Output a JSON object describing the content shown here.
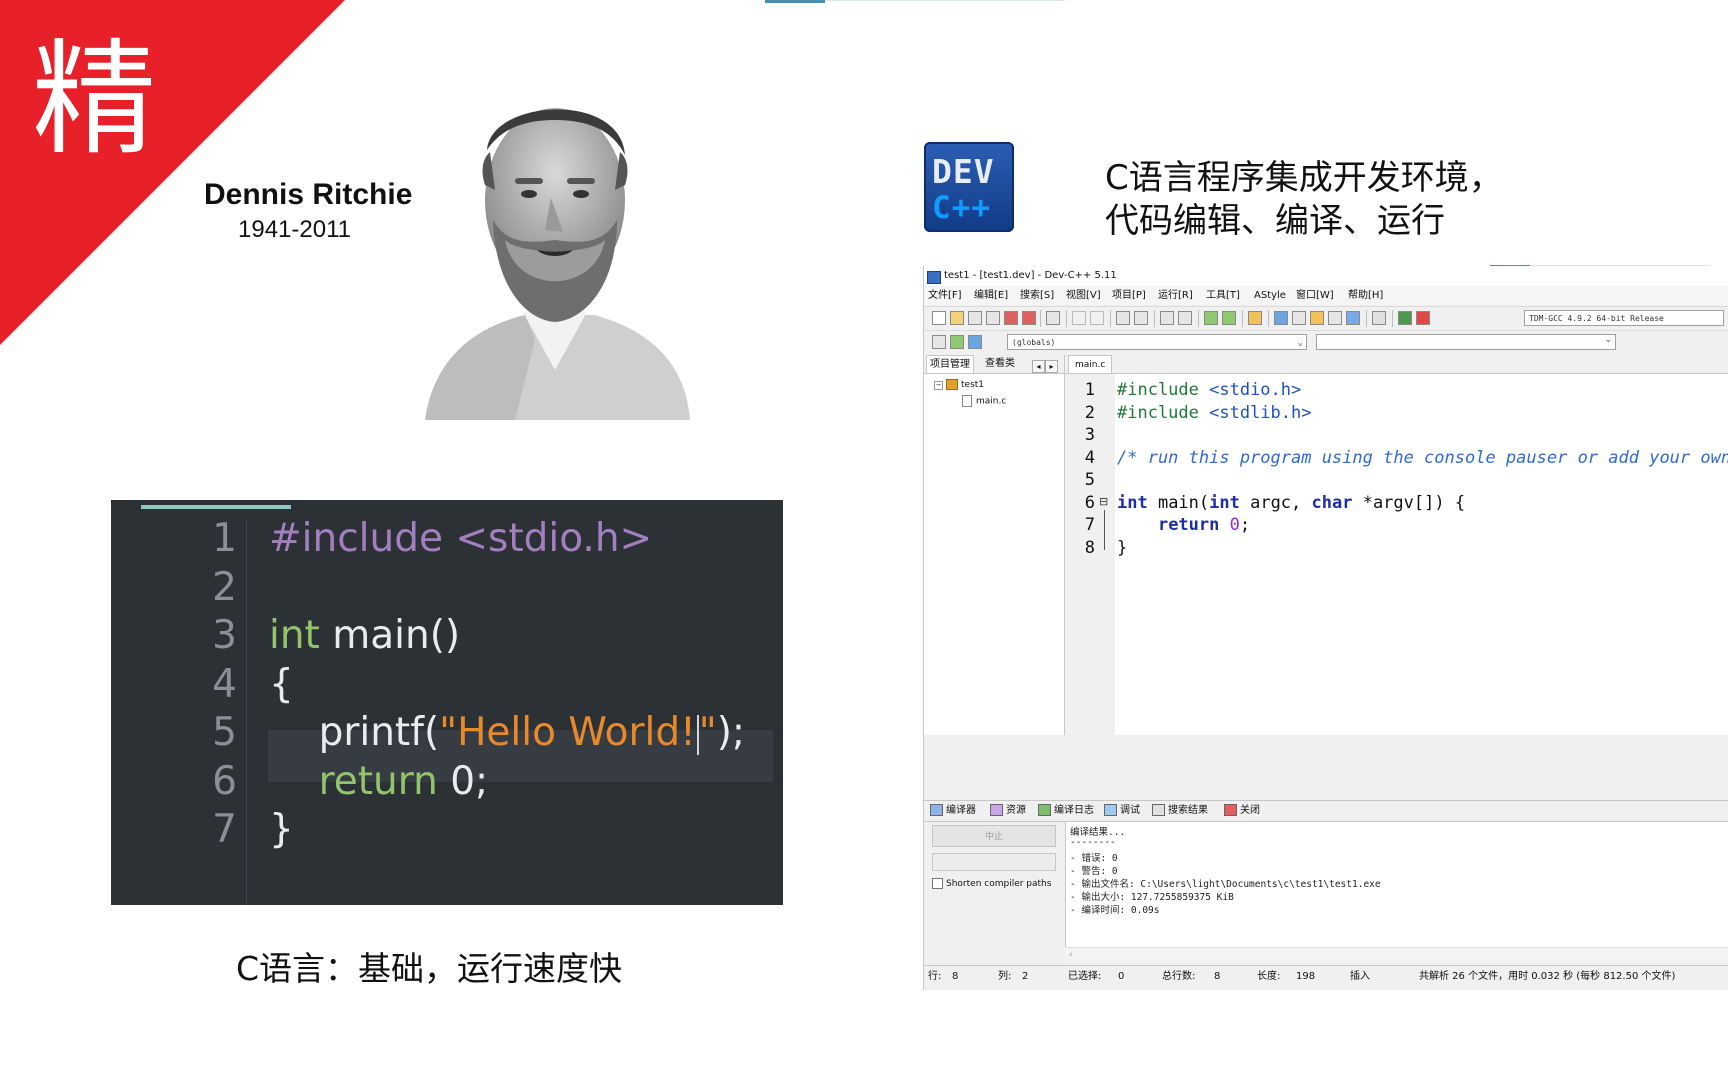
{
  "corner": {
    "char": "精"
  },
  "ritchie": {
    "name": "Dennis Ritchie",
    "years": "1941-2011"
  },
  "code_example": {
    "lines": [
      {
        "num": "1",
        "tokens": [
          {
            "t": "#include <stdio.h>",
            "c": "pre"
          }
        ]
      },
      {
        "num": "2",
        "tokens": []
      },
      {
        "num": "3",
        "tokens": [
          {
            "t": "int",
            "c": "kw"
          },
          {
            "t": " main()",
            "c": ""
          }
        ]
      },
      {
        "num": "4",
        "tokens": [
          {
            "t": "{",
            "c": ""
          }
        ]
      },
      {
        "num": "5",
        "tokens": [
          {
            "t": "    printf(",
            "c": ""
          },
          {
            "t": "\"Hello World!",
            "c": "str"
          },
          {
            "t": "CARET",
            "c": "caret"
          },
          {
            "t": "\"",
            "c": "str"
          },
          {
            "t": ");",
            "c": ""
          }
        ]
      },
      {
        "num": "6",
        "tokens": [
          {
            "t": "    ",
            "c": ""
          },
          {
            "t": "return",
            "c": "kw"
          },
          {
            "t": " 0;",
            "c": ""
          }
        ]
      },
      {
        "num": "7",
        "tokens": [
          {
            "t": "}",
            "c": ""
          }
        ]
      }
    ],
    "colors": {
      "background": "#2c3135",
      "preprocessor": "#a37fbf",
      "keyword": "#92c46b",
      "string": "#e8892b"
    }
  },
  "caption_left": "C语言：基础，运行速度快",
  "devcpp_logo": {
    "top": "DEV",
    "bottom": "C++"
  },
  "title_right": {
    "line1": "C语言程序集成开发环境，",
    "line2": "代码编辑、编译、运行"
  },
  "ide": {
    "window_title": "test1 - [test1.dev] - Dev-C++ 5.11",
    "menu": [
      "文件[F]",
      "编辑[E]",
      "搜索[S]",
      "视图[V]",
      "项目[P]",
      "运行[R]",
      "工具[T]",
      "AStyle",
      "窗口[W]",
      "帮助[H]"
    ],
    "compiler_select": "TDM-GCC 4.9.2 64-bit Release",
    "scope_select": "(globals)",
    "left_tabs": [
      "项目管理",
      "查看类"
    ],
    "tree": {
      "project": "test1",
      "file": "main.c"
    },
    "editor_tab": "main.c",
    "editor_lines": [
      {
        "num": "1",
        "tokens": [
          {
            "t": "#include ",
            "c": "pre"
          },
          {
            "t": "<stdio.h>",
            "c": "hdr"
          }
        ]
      },
      {
        "num": "2",
        "tokens": [
          {
            "t": "#include ",
            "c": "pre"
          },
          {
            "t": "<stdlib.h>",
            "c": "hdr"
          }
        ]
      },
      {
        "num": "3",
        "tokens": []
      },
      {
        "num": "4",
        "tokens": [
          {
            "t": "/* run this program using the console pauser or add your own getch, system(\"pause\") or input loop */",
            "c": "cmt"
          }
        ]
      },
      {
        "num": "5",
        "tokens": []
      },
      {
        "num": "6",
        "tokens": [
          {
            "t": "int",
            "c": "type"
          },
          {
            "t": " main(",
            "c": ""
          },
          {
            "t": "int",
            "c": "type"
          },
          {
            "t": " argc, ",
            "c": ""
          },
          {
            "t": "char",
            "c": "type"
          },
          {
            "t": " *argv[]) {",
            "c": ""
          }
        ]
      },
      {
        "num": "7",
        "tokens": [
          {
            "t": "    ",
            "c": ""
          },
          {
            "t": "return",
            "c": "type"
          },
          {
            "t": " ",
            "c": ""
          },
          {
            "t": "0",
            "c": "num"
          },
          {
            "t": ";",
            "c": ""
          }
        ]
      },
      {
        "num": "8",
        "tokens": [
          {
            "t": "}",
            "c": ""
          }
        ]
      }
    ],
    "bottom_tabs": [
      "编译器",
      "资源",
      "编译日志",
      "调试",
      "搜索结果",
      "关闭"
    ],
    "stop_button": "中止",
    "shorten_label": "Shorten compiler paths",
    "log_lines": [
      "编译结果...",
      "--------",
      "- 错误: 0",
      "- 警告: 0",
      "- 输出文件名: C:\\Users\\light\\Documents\\c\\test1\\test1.exe",
      "- 输出大小: 127.7255859375 KiB",
      "- 编译时间: 0.09s"
    ],
    "status": {
      "row_label": "行:",
      "row": "8",
      "col_label": "列:",
      "col": "2",
      "sel_label": "已选择:",
      "sel": "0",
      "total_label": "总行数:",
      "total": "8",
      "len_label": "长度:",
      "len": "198",
      "mode": "插入",
      "parse": "共解析 26 个文件，用时 0.032 秒 (每秒 812.50 个文件)"
    }
  }
}
